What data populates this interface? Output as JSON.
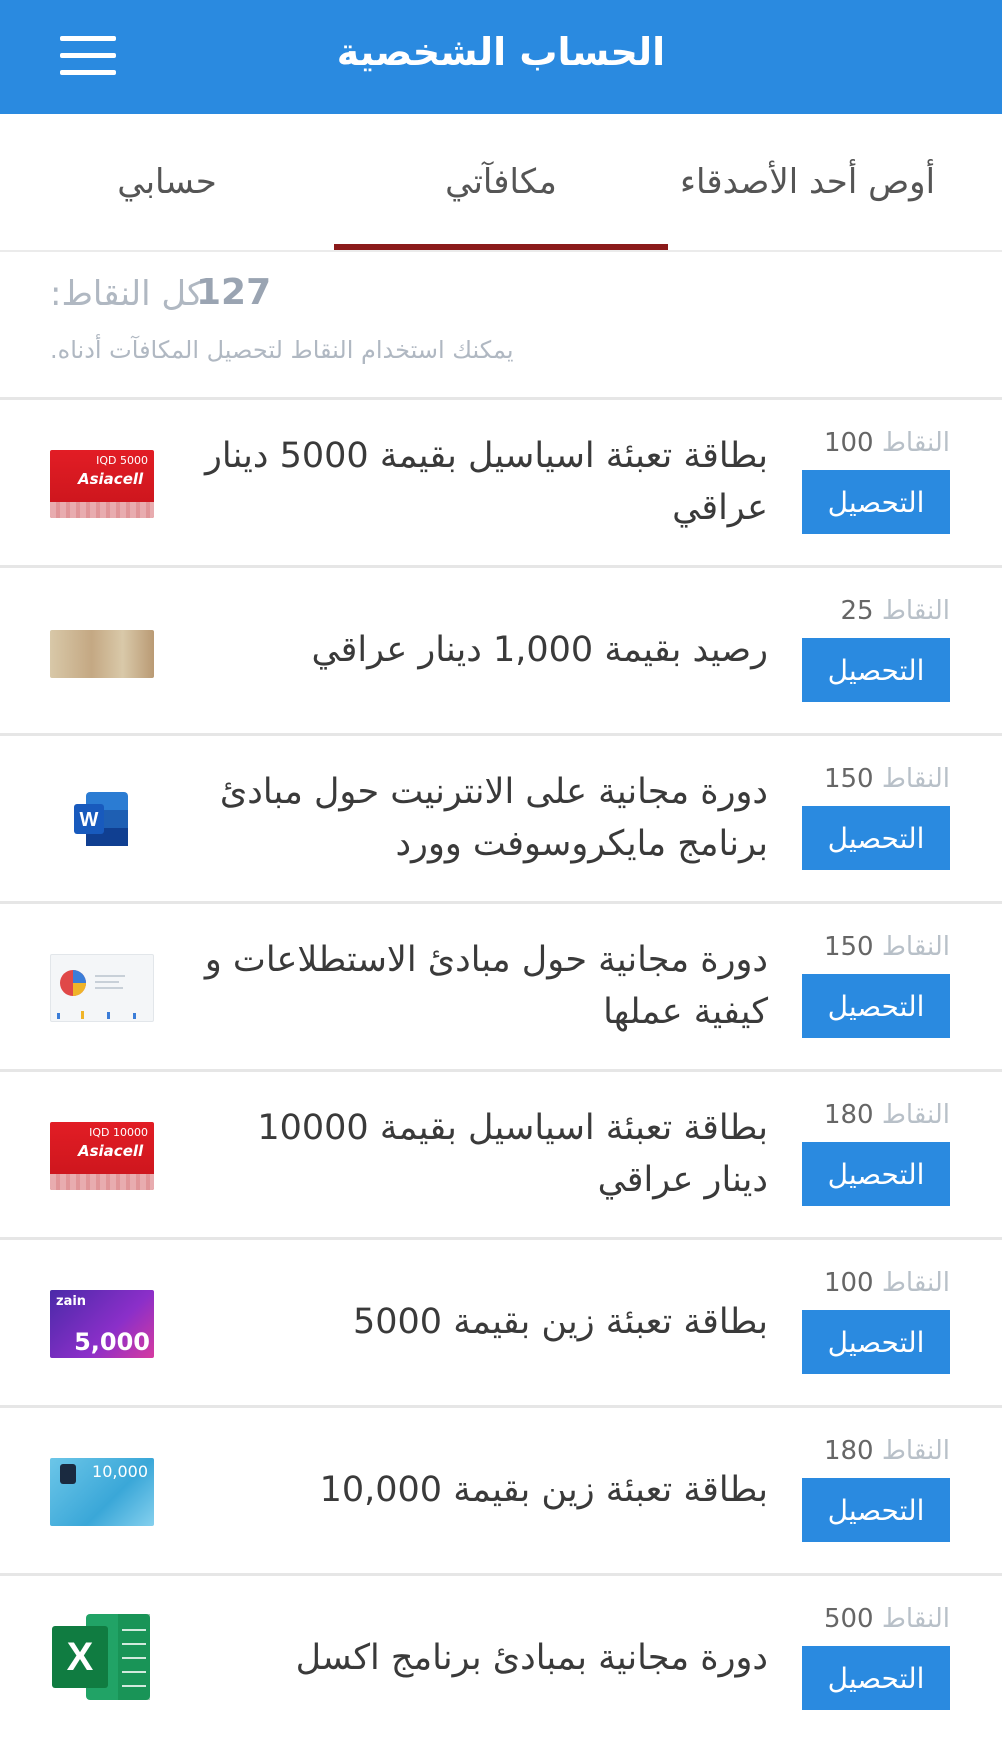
{
  "appbar": {
    "title": "الحساب الشخصية"
  },
  "tabs": [
    {
      "label": "أوص أحد الأصدقاء"
    },
    {
      "label": "مكافآتي"
    },
    {
      "label": "حسابي"
    }
  ],
  "points": {
    "label": "كل النقاط:",
    "value": "127",
    "hint": "يمكنك استخدام النقاط لتحصيل المكافآت أدناه."
  },
  "rewards": [
    {
      "title": "بطاقة تعبئة اسياسيل بقيمة 5000 دينار عراقي",
      "points_label": "النقاط",
      "points": "100",
      "button": "التحصيل",
      "thumb": "asiacell-5000",
      "thumb_text": "IQD 5000",
      "logo_text": "Asiacell"
    },
    {
      "title": "رصيد بقيمة 1,000 دينار عراقي",
      "points_label": "النقاط",
      "points": "25",
      "button": "التحصيل",
      "thumb": "dinar-note"
    },
    {
      "title": "دورة مجانية على الانترنيت حول مبادئ برنامج مايكروسوفت وورد",
      "points_label": "النقاط",
      "points": "150",
      "button": "التحصيل",
      "thumb": "word-icon"
    },
    {
      "title": "دورة مجانية حول مبادئ الاستطلاعات و كيفية عملها",
      "points_label": "النقاط",
      "points": "150",
      "button": "التحصيل",
      "thumb": "survey-chart"
    },
    {
      "title": "بطاقة تعبئة اسياسيل بقيمة 10000 دينار عراقي",
      "points_label": "النقاط",
      "points": "180",
      "button": "التحصيل",
      "thumb": "asiacell-10000",
      "thumb_text": "IQD 10000",
      "logo_text": "Asiacell"
    },
    {
      "title": "بطاقة تعبئة زين بقيمة 5000",
      "points_label": "النقاط",
      "points": "100",
      "button": "التحصيل",
      "thumb": "zain-5000",
      "thumb_text": "5,000",
      "logo_text": "zain"
    },
    {
      "title": "بطاقة تعبئة زين بقيمة 10,000",
      "points_label": "النقاط",
      "points": "180",
      "button": "التحصيل",
      "thumb": "zain-10000",
      "thumb_text": "10,000"
    },
    {
      "title": "دورة مجانية بمبادئ برنامج اكسل",
      "points_label": "النقاط",
      "points": "500",
      "button": "التحصيل",
      "thumb": "excel-icon"
    }
  ],
  "colors": {
    "primary": "#2a8ae0",
    "tab_indicator": "#8b1a1a"
  }
}
